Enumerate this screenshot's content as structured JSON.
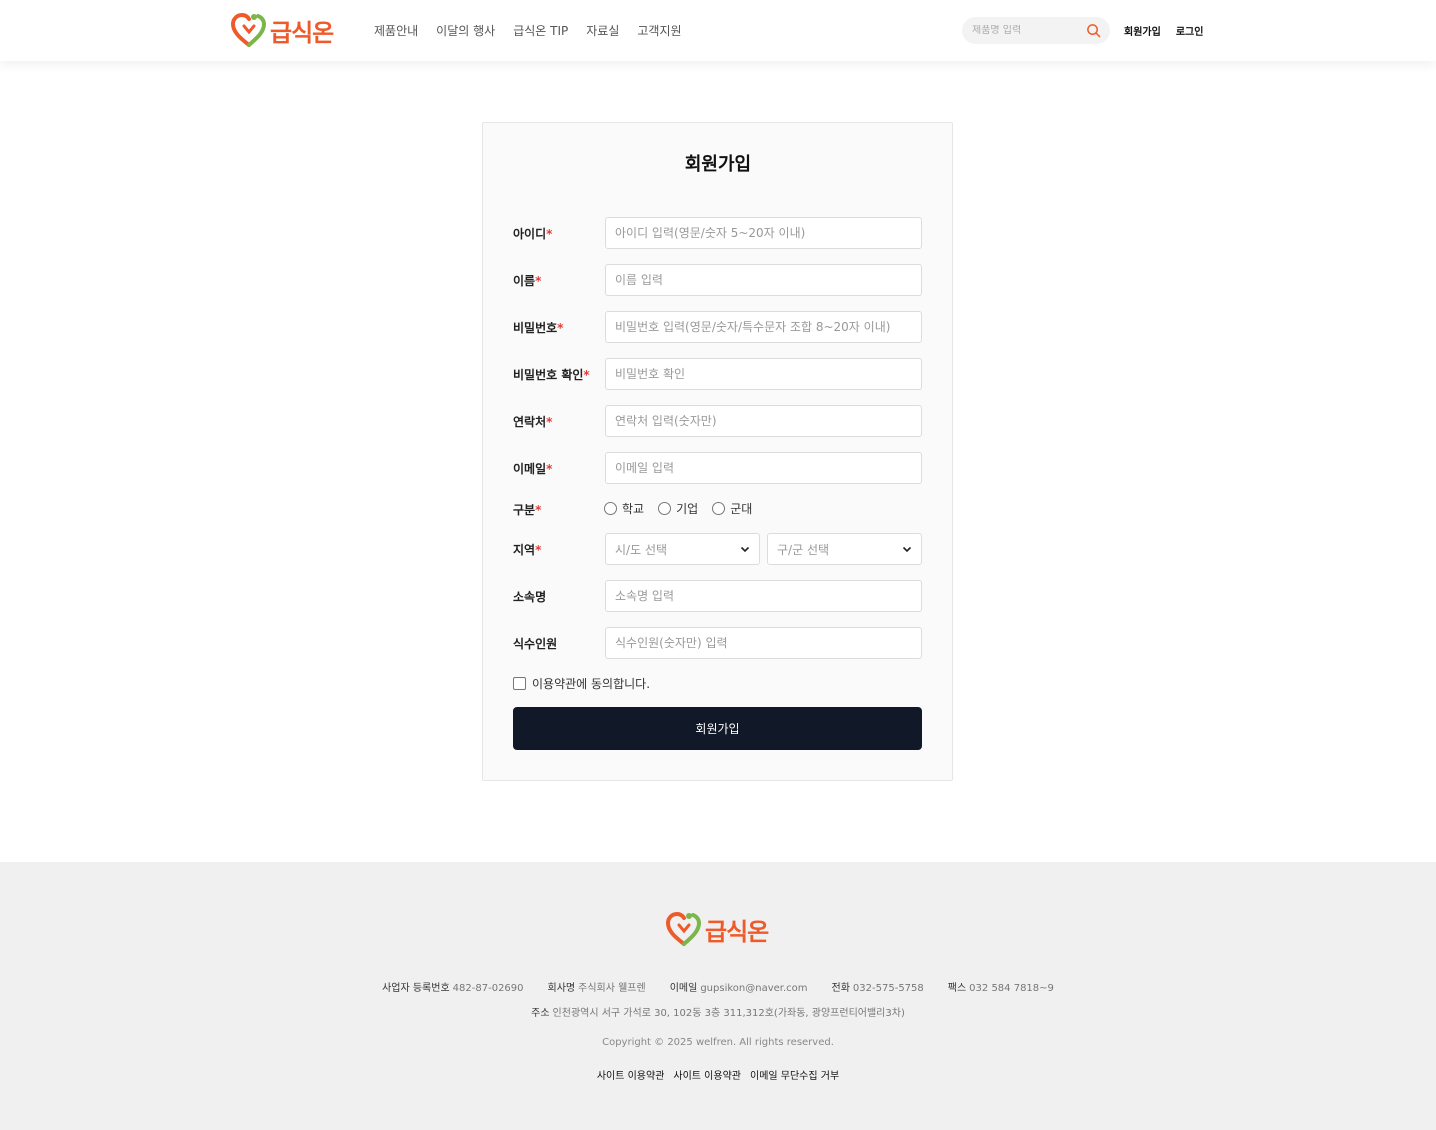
{
  "brand": {
    "name": "급식온",
    "accent": "#ef5a2a",
    "heart_green": "#7ab648"
  },
  "header": {
    "nav": [
      "제품안내",
      "이달의 행사",
      "급식온 TIP",
      "자료실",
      "고객지원"
    ],
    "search_placeholder": "제품명 입력",
    "signup_link": "회원가입",
    "login_link": "로그인"
  },
  "form": {
    "title": "회원가입",
    "required_mark": "*",
    "fields": {
      "user_id": {
        "label": "아이디",
        "placeholder": "아이디 입력(영문/숫자 5~20자 이내)"
      },
      "name": {
        "label": "이름",
        "placeholder": "이름 입력"
      },
      "password": {
        "label": "비밀번호",
        "placeholder": "비밀번호 입력(영문/숫자/특수문자 조합 8~20자 이내)"
      },
      "password_confirm": {
        "label": "비밀번호 확인",
        "placeholder": "비밀번호 확인"
      },
      "phone": {
        "label": "연락처",
        "placeholder": "연락처 입력(숫자만)"
      },
      "email": {
        "label": "이메일",
        "placeholder": "이메일 입력"
      },
      "affiliation": {
        "label": "소속명",
        "placeholder": "소속명 입력"
      },
      "headcount": {
        "label": "식수인원",
        "placeholder": "식수인원(숫자만) 입력"
      }
    },
    "category": {
      "label": "구분",
      "options": [
        "학교",
        "기업",
        "군대"
      ]
    },
    "region": {
      "label": "지역",
      "city_placeholder": "시/도 선택",
      "district_placeholder": "구/군 선택"
    },
    "agree_label": "이용약관에 동의합니다.",
    "submit_label": "회원가입",
    "submit_color": "#111827"
  },
  "footer": {
    "info": [
      {
        "key": "사업자 등록번호",
        "value": "482-87-02690"
      },
      {
        "key": "회사명",
        "value": "주식회사 웰프렌"
      },
      {
        "key": "이메일",
        "value": "gupsikon@naver.com"
      },
      {
        "key": "전화",
        "value": "032-575-5758"
      },
      {
        "key": "팩스",
        "value": "032 584 7818~9"
      }
    ],
    "address_key": "주소",
    "address_value": "인천광역시 서구 가석로 30, 102동 3층 311,312호(가좌동, 광양프런티어밸리3차)",
    "copyright": "Copyright © 2025 welfren. All rights reserved.",
    "links": [
      "사이트 이용약관",
      "사이트 이용약관",
      "이메일 무단수집 거부"
    ]
  }
}
